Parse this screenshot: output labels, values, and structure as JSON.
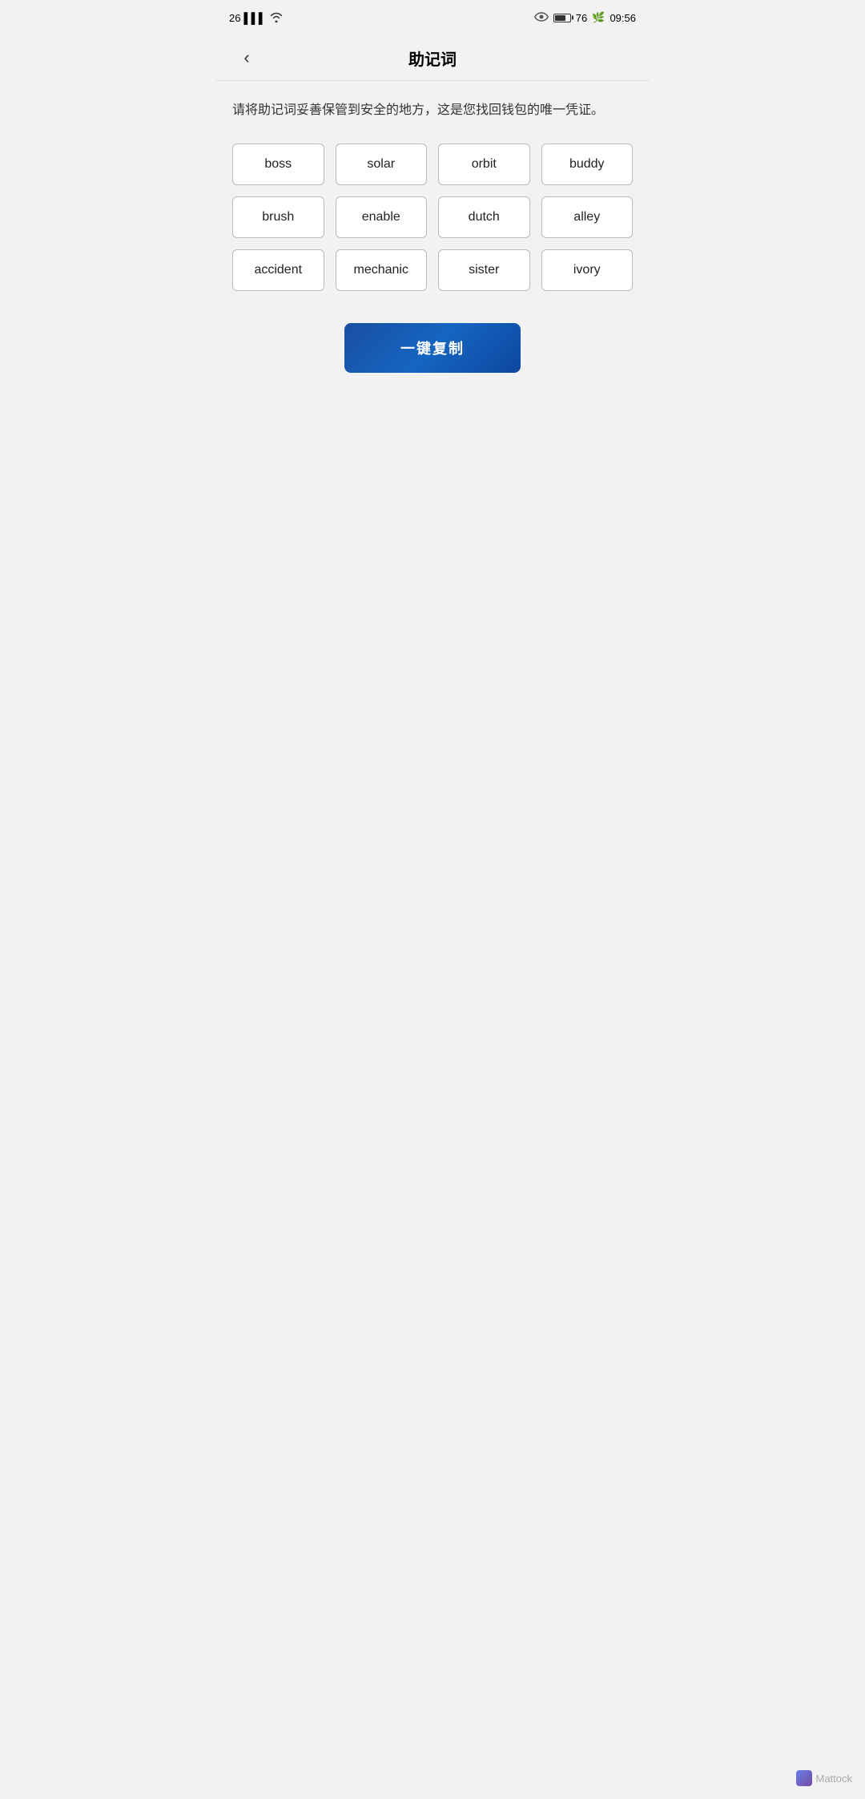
{
  "statusBar": {
    "network": "26",
    "time": "09:56",
    "batteryLevel": 76
  },
  "header": {
    "title": "助记词",
    "backLabel": "‹"
  },
  "description": "请将助记词妥善保管到安全的地方，这是您找回钱包的唯一凭证。",
  "words": [
    "boss",
    "solar",
    "orbit",
    "buddy",
    "brush",
    "enable",
    "dutch",
    "alley",
    "accident",
    "mechanic",
    "sister",
    "ivory"
  ],
  "copyButton": {
    "label": "一键复制"
  },
  "footer": {
    "watermark": "Mattock"
  }
}
